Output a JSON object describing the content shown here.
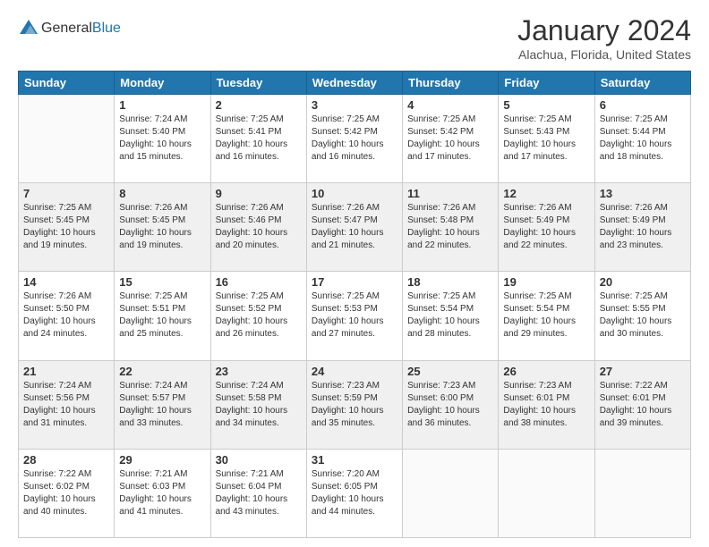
{
  "header": {
    "logo": {
      "text_general": "General",
      "text_blue": "Blue"
    },
    "title": "January 2024",
    "location": "Alachua, Florida, United States"
  },
  "calendar": {
    "columns": [
      "Sunday",
      "Monday",
      "Tuesday",
      "Wednesday",
      "Thursday",
      "Friday",
      "Saturday"
    ],
    "weeks": [
      [
        {
          "day": "",
          "info": ""
        },
        {
          "day": "1",
          "info": "Sunrise: 7:24 AM\nSunset: 5:40 PM\nDaylight: 10 hours\nand 15 minutes."
        },
        {
          "day": "2",
          "info": "Sunrise: 7:25 AM\nSunset: 5:41 PM\nDaylight: 10 hours\nand 16 minutes."
        },
        {
          "day": "3",
          "info": "Sunrise: 7:25 AM\nSunset: 5:42 PM\nDaylight: 10 hours\nand 16 minutes."
        },
        {
          "day": "4",
          "info": "Sunrise: 7:25 AM\nSunset: 5:42 PM\nDaylight: 10 hours\nand 17 minutes."
        },
        {
          "day": "5",
          "info": "Sunrise: 7:25 AM\nSunset: 5:43 PM\nDaylight: 10 hours\nand 17 minutes."
        },
        {
          "day": "6",
          "info": "Sunrise: 7:25 AM\nSunset: 5:44 PM\nDaylight: 10 hours\nand 18 minutes."
        }
      ],
      [
        {
          "day": "7",
          "info": "Sunrise: 7:25 AM\nSunset: 5:45 PM\nDaylight: 10 hours\nand 19 minutes."
        },
        {
          "day": "8",
          "info": "Sunrise: 7:26 AM\nSunset: 5:45 PM\nDaylight: 10 hours\nand 19 minutes."
        },
        {
          "day": "9",
          "info": "Sunrise: 7:26 AM\nSunset: 5:46 PM\nDaylight: 10 hours\nand 20 minutes."
        },
        {
          "day": "10",
          "info": "Sunrise: 7:26 AM\nSunset: 5:47 PM\nDaylight: 10 hours\nand 21 minutes."
        },
        {
          "day": "11",
          "info": "Sunrise: 7:26 AM\nSunset: 5:48 PM\nDaylight: 10 hours\nand 22 minutes."
        },
        {
          "day": "12",
          "info": "Sunrise: 7:26 AM\nSunset: 5:49 PM\nDaylight: 10 hours\nand 22 minutes."
        },
        {
          "day": "13",
          "info": "Sunrise: 7:26 AM\nSunset: 5:49 PM\nDaylight: 10 hours\nand 23 minutes."
        }
      ],
      [
        {
          "day": "14",
          "info": "Sunrise: 7:26 AM\nSunset: 5:50 PM\nDaylight: 10 hours\nand 24 minutes."
        },
        {
          "day": "15",
          "info": "Sunrise: 7:25 AM\nSunset: 5:51 PM\nDaylight: 10 hours\nand 25 minutes."
        },
        {
          "day": "16",
          "info": "Sunrise: 7:25 AM\nSunset: 5:52 PM\nDaylight: 10 hours\nand 26 minutes."
        },
        {
          "day": "17",
          "info": "Sunrise: 7:25 AM\nSunset: 5:53 PM\nDaylight: 10 hours\nand 27 minutes."
        },
        {
          "day": "18",
          "info": "Sunrise: 7:25 AM\nSunset: 5:54 PM\nDaylight: 10 hours\nand 28 minutes."
        },
        {
          "day": "19",
          "info": "Sunrise: 7:25 AM\nSunset: 5:54 PM\nDaylight: 10 hours\nand 29 minutes."
        },
        {
          "day": "20",
          "info": "Sunrise: 7:25 AM\nSunset: 5:55 PM\nDaylight: 10 hours\nand 30 minutes."
        }
      ],
      [
        {
          "day": "21",
          "info": "Sunrise: 7:24 AM\nSunset: 5:56 PM\nDaylight: 10 hours\nand 31 minutes."
        },
        {
          "day": "22",
          "info": "Sunrise: 7:24 AM\nSunset: 5:57 PM\nDaylight: 10 hours\nand 33 minutes."
        },
        {
          "day": "23",
          "info": "Sunrise: 7:24 AM\nSunset: 5:58 PM\nDaylight: 10 hours\nand 34 minutes."
        },
        {
          "day": "24",
          "info": "Sunrise: 7:23 AM\nSunset: 5:59 PM\nDaylight: 10 hours\nand 35 minutes."
        },
        {
          "day": "25",
          "info": "Sunrise: 7:23 AM\nSunset: 6:00 PM\nDaylight: 10 hours\nand 36 minutes."
        },
        {
          "day": "26",
          "info": "Sunrise: 7:23 AM\nSunset: 6:01 PM\nDaylight: 10 hours\nand 38 minutes."
        },
        {
          "day": "27",
          "info": "Sunrise: 7:22 AM\nSunset: 6:01 PM\nDaylight: 10 hours\nand 39 minutes."
        }
      ],
      [
        {
          "day": "28",
          "info": "Sunrise: 7:22 AM\nSunset: 6:02 PM\nDaylight: 10 hours\nand 40 minutes."
        },
        {
          "day": "29",
          "info": "Sunrise: 7:21 AM\nSunset: 6:03 PM\nDaylight: 10 hours\nand 41 minutes."
        },
        {
          "day": "30",
          "info": "Sunrise: 7:21 AM\nSunset: 6:04 PM\nDaylight: 10 hours\nand 43 minutes."
        },
        {
          "day": "31",
          "info": "Sunrise: 7:20 AM\nSunset: 6:05 PM\nDaylight: 10 hours\nand 44 minutes."
        },
        {
          "day": "",
          "info": ""
        },
        {
          "day": "",
          "info": ""
        },
        {
          "day": "",
          "info": ""
        }
      ]
    ]
  }
}
